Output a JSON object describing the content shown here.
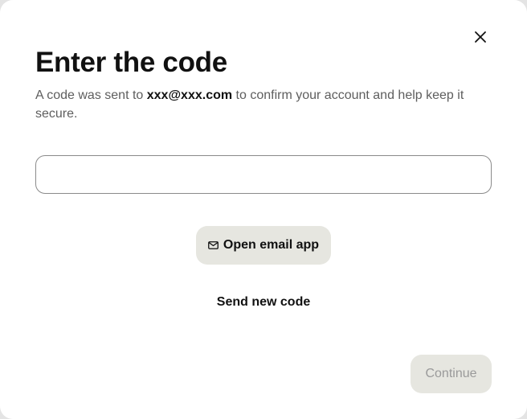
{
  "dialog": {
    "title": "Enter the code",
    "subtitle_before": "A code was sent to ",
    "email": "xxx@xxx.com",
    "subtitle_after": " to confirm your account and help keep it secure.",
    "close_icon": "close-icon"
  },
  "code_input": {
    "value": "",
    "placeholder": ""
  },
  "actions": {
    "open_email_label": "Open email app",
    "open_email_icon": "mail-icon",
    "send_new_code_label": "Send new code",
    "continue_label": "Continue",
    "continue_enabled": false
  }
}
